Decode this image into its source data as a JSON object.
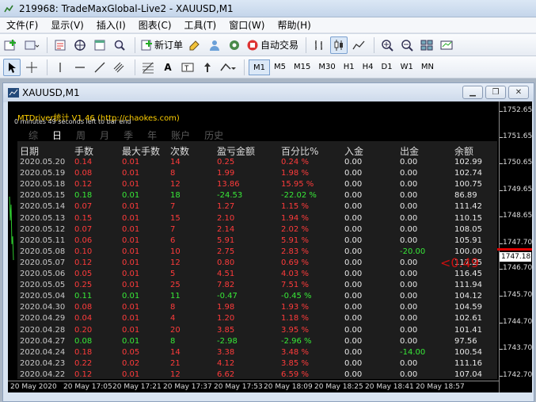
{
  "window": {
    "title": "219968: TradeMaxGlobal-Live2 - XAUUSD,M1"
  },
  "menu": [
    "文件(F)",
    "显示(V)",
    "插入(I)",
    "图表(C)",
    "工具(T)",
    "窗口(W)",
    "帮助(H)"
  ],
  "toolbar": {
    "new_order": "新订单",
    "auto_trade": "自动交易"
  },
  "timeframes": [
    "M1",
    "M5",
    "M15",
    "M30",
    "H1",
    "H4",
    "D1",
    "W1",
    "MN"
  ],
  "selected_timeframe": "M1",
  "chart_window": {
    "title": "XAUUSD,M1"
  },
  "ea": {
    "title": "MTDriver统计 V1.46  (http://chaokes.com)",
    "countdown": "0 minutes 49 seconds left to bar end",
    "tabs": [
      "综",
      "日",
      "周",
      "月",
      "季",
      "年",
      "账户",
      "历史"
    ],
    "active_tab": "日",
    "columns": [
      "日期",
      "手数",
      "最大手数",
      "次数",
      "盈亏金额",
      "百分比%",
      "入金",
      "出金",
      "余额"
    ],
    "rows": [
      [
        "2020.05.20",
        "0.14",
        "0.01",
        "14",
        "0.25",
        "0.24 %",
        "0.00",
        "0.00",
        "102.99",
        "r"
      ],
      [
        "2020.05.19",
        "0.08",
        "0.01",
        "8",
        "1.99",
        "1.98 %",
        "0.00",
        "0.00",
        "102.74",
        "r"
      ],
      [
        "2020.05.18",
        "0.12",
        "0.01",
        "12",
        "13.86",
        "15.95 %",
        "0.00",
        "0.00",
        "100.75",
        "r"
      ],
      [
        "2020.05.15",
        "0.18",
        "0.01",
        "18",
        "-24.53",
        "-22.02 %",
        "0.00",
        "0.00",
        "86.89",
        "g"
      ],
      [
        "2020.05.14",
        "0.07",
        "0.01",
        "7",
        "1.27",
        "1.15 %",
        "0.00",
        "0.00",
        "111.42",
        "r"
      ],
      [
        "2020.05.13",
        "0.15",
        "0.01",
        "15",
        "2.10",
        "1.94 %",
        "0.00",
        "0.00",
        "110.15",
        "r"
      ],
      [
        "2020.05.12",
        "0.07",
        "0.01",
        "7",
        "2.14",
        "2.02 %",
        "0.00",
        "0.00",
        "108.05",
        "r"
      ],
      [
        "2020.05.11",
        "0.06",
        "0.01",
        "6",
        "5.91",
        "5.91 %",
        "0.00",
        "0.00",
        "105.91",
        "r"
      ],
      [
        "2020.05.08",
        "0.10",
        "0.01",
        "10",
        "2.75",
        "2.83 %",
        "0.00",
        "-20.00",
        "100.00",
        "r"
      ],
      [
        "2020.05.07",
        "0.12",
        "0.01",
        "12",
        "0.80",
        "0.69 %",
        "0.00",
        "0.00",
        "117.25",
        "r"
      ],
      [
        "2020.05.06",
        "0.05",
        "0.01",
        "5",
        "4.51",
        "4.03 %",
        "0.00",
        "0.00",
        "116.45",
        "r"
      ],
      [
        "2020.05.05",
        "0.25",
        "0.01",
        "25",
        "7.82",
        "7.51 %",
        "0.00",
        "0.00",
        "111.94",
        "r"
      ],
      [
        "2020.05.04",
        "0.11",
        "0.01",
        "11",
        "-0.47",
        "-0.45 %",
        "0.00",
        "0.00",
        "104.12",
        "g"
      ],
      [
        "2020.04.30",
        "0.08",
        "0.01",
        "8",
        "1.98",
        "1.93 %",
        "0.00",
        "0.00",
        "104.59",
        "r"
      ],
      [
        "2020.04.29",
        "0.04",
        "0.01",
        "4",
        "1.20",
        "1.18 %",
        "0.00",
        "0.00",
        "102.61",
        "r"
      ],
      [
        "2020.04.28",
        "0.20",
        "0.01",
        "20",
        "3.85",
        "3.95 %",
        "0.00",
        "0.00",
        "101.41",
        "r"
      ],
      [
        "2020.04.27",
        "0.08",
        "0.01",
        "8",
        "-2.98",
        "-2.96 %",
        "0.00",
        "0.00",
        "97.56",
        "g"
      ],
      [
        "2020.04.24",
        "0.18",
        "0.05",
        "14",
        "3.38",
        "3.48 %",
        "0.00",
        "-14.00",
        "100.54",
        "r"
      ],
      [
        "2020.04.23",
        "0.22",
        "0.02",
        "21",
        "4.12",
        "3.85 %",
        "0.00",
        "0.00",
        "111.16",
        "r"
      ],
      [
        "2020.04.22",
        "0.12",
        "0.01",
        "12",
        "6.62",
        "6.59 %",
        "0.00",
        "0.00",
        "107.04",
        "r"
      ]
    ]
  },
  "y_axis": [
    "1752.65",
    "1751.65",
    "1750.65",
    "1749.65",
    "1748.65",
    "1747.70",
    "1746.70",
    "1745.70",
    "1744.70",
    "1743.70",
    "1742.70"
  ],
  "current_price": "1747.18",
  "overlay_text": "<0.49",
  "x_axis": [
    "20 May 2020",
    "20 May 17:05",
    "20 May 17:21",
    "20 May 17:37",
    "20 May 17:53",
    "20 May 18:09",
    "20 May 18:25",
    "20 May 18:41",
    "20 May 18:57"
  ],
  "colors": {
    "profit": "#ff3b3b",
    "loss": "#38e838",
    "price_line": "#e00000",
    "ea_title": "#ffd000"
  }
}
